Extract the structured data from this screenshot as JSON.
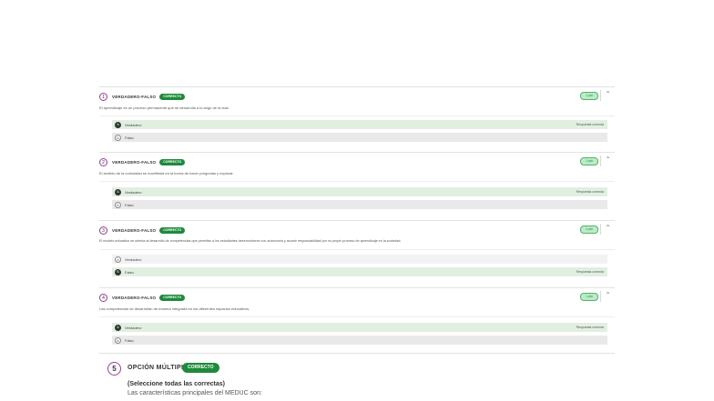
{
  "questions": [
    {
      "number": "1",
      "type": "VERDADERO-FALSO",
      "badge": "CORRECTO",
      "score": "1 pto",
      "text": "El aprendizaje es un proceso permanente que se desarrolla a lo largo de la vida.",
      "options": [
        {
          "marker": "A",
          "label": "Verdadero",
          "status": "Respuesta correcta"
        },
        {
          "marker": "B",
          "label": "Falso",
          "status": ""
        }
      ]
    },
    {
      "number": "2",
      "type": "VERDADERO-FALSO",
      "badge": "CORRECTO",
      "score": "1 pto",
      "text": "El sentido de la curiosidad se manifiesta en la forma de hacer preguntas y explorar.",
      "options": [
        {
          "marker": "A",
          "label": "Verdadero",
          "status": "Respuesta correcta"
        },
        {
          "marker": "B",
          "label": "Falso",
          "status": ""
        }
      ]
    },
    {
      "number": "3",
      "type": "VERDADERO-FALSO",
      "badge": "CORRECTO",
      "score": "1 pto",
      "text": "El modelo educativo se orienta al desarrollo de competencias que permitan a los estudiantes desenvolverse con autonomía y asumir responsabilidad por su propio proceso de aprendizaje en la sociedad.",
      "options": [
        {
          "marker": "A",
          "label": "Verdadero",
          "status": ""
        },
        {
          "marker": "B",
          "label": "Falso",
          "status": "Respuesta correcta"
        }
      ]
    },
    {
      "number": "4",
      "type": "VERDADERO-FALSO",
      "badge": "CORRECTO",
      "score": "1 pto",
      "text": "Las competencias se desarrollan de manera integrada en los diferentes espacios educativos.",
      "options": [
        {
          "marker": "A",
          "label": "Verdadero",
          "status": "Respuesta correcta"
        },
        {
          "marker": "B",
          "label": "Falso",
          "status": ""
        }
      ]
    }
  ],
  "question5": {
    "number": "5",
    "type": "OPCIÓN MÚLTIPLE",
    "badge": "CORRECTO",
    "hint": "(Seleccione todas las correctas)",
    "text": "Las características principales del MEDUC son:"
  },
  "icons": {
    "chevron": "chevron-up-icon"
  },
  "colors": {
    "accent_purple": "#9b3a96",
    "correct_green": "#1f8a3c",
    "score_green_bg": "#bfe9c9"
  }
}
